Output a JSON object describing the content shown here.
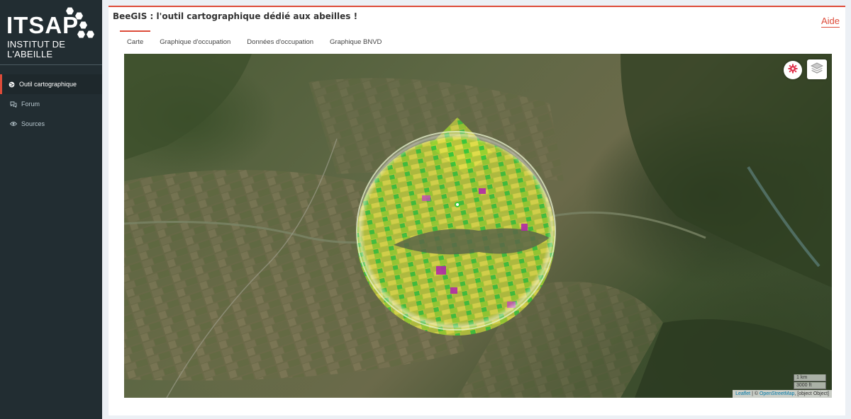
{
  "logo": {
    "title": "ITSAP",
    "subtitle": "INSTITUT DE L'ABEILLE"
  },
  "sidebar": {
    "items": [
      {
        "label": "Outil cartographique",
        "icon": "globe-icon",
        "active": true
      },
      {
        "label": "Forum",
        "icon": "comments-icon",
        "active": false
      },
      {
        "label": "Sources",
        "icon": "eye-icon",
        "active": false
      }
    ]
  },
  "page": {
    "title": "BeeGIS : l'outil cartographique dédié aux abeilles !",
    "help_label": "Aide"
  },
  "tabs": [
    {
      "label": "Carte",
      "active": true
    },
    {
      "label": "Graphique d'occupation",
      "active": false
    },
    {
      "label": "Données d'occupation",
      "active": false
    },
    {
      "label": "Graphique BNVD",
      "active": false
    }
  ],
  "map": {
    "controls": {
      "settings_icon": "gear-icon",
      "layers_icon": "layers-icon"
    },
    "scale": {
      "metric": "1 km",
      "imperial": "3000 ft"
    },
    "attribution": {
      "leaflet": "Leaflet",
      "separator": " | © ",
      "osm": "OpenStreetMap",
      "extra": ", [object Object]"
    }
  },
  "colors": {
    "accent": "#dd4b39",
    "sidebar": "#222d32",
    "link": "#0078a8"
  }
}
